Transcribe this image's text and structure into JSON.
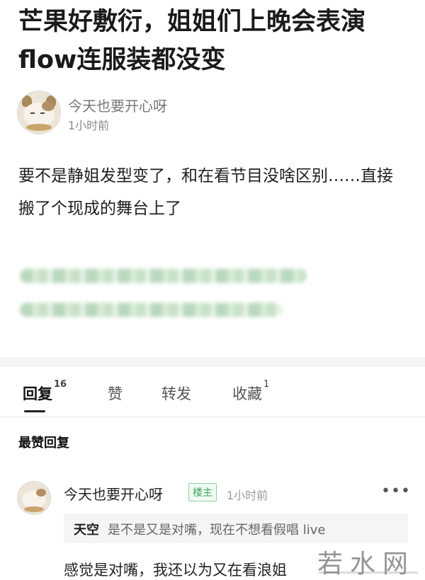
{
  "post": {
    "title": "芒果好敷衍，姐姐们上晚会表演flow连服装都没变",
    "author": "今天也要开心呀",
    "time": "1小时前",
    "content": "要不是静姐发型变了，和在看节目没啥区别……直接搬了个现成的舞台上了"
  },
  "tabs": [
    {
      "label": "回复",
      "count": "16"
    },
    {
      "label": "赞",
      "count": ""
    },
    {
      "label": "转发",
      "count": ""
    },
    {
      "label": "收藏",
      "count": "1"
    }
  ],
  "section_title": "最赞回复",
  "comment": {
    "author": "今天也要开心呀",
    "badge": "楼主",
    "time": "1小时前",
    "more": "•••",
    "quote_user": "天空",
    "quote_text": "是不是又是对嘴，现在不想看假唱 live",
    "text": "感觉是对嘴，我还以为又在看浪姐"
  },
  "watermark": "若水网",
  "colors": {
    "accent_green": "#3aa55a",
    "blurred_link": "#b9d9bd"
  }
}
